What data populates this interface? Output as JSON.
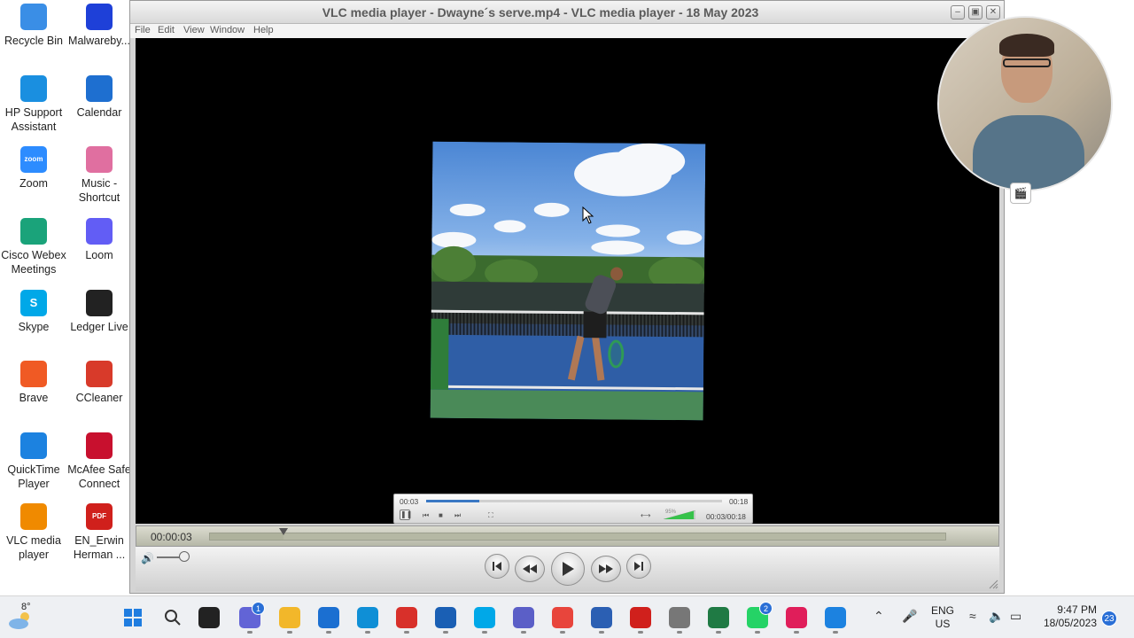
{
  "desktop": {
    "icons": [
      {
        "label": "Recycle Bin",
        "icon": "recycle-bin-icon",
        "color": "#3a8ee6"
      },
      {
        "label": "Malwareby...",
        "icon": "malwarebytes-icon",
        "color": "#1e40d8"
      },
      {
        "label": "HP Support Assistant",
        "icon": "hp-support-icon",
        "color": "#1a8fe0"
      },
      {
        "label": "Calendar",
        "icon": "calendar-icon",
        "color": "#1e6fd0"
      },
      {
        "label": "Zoom",
        "icon": "zoom-icon",
        "color": "#2d8cff",
        "glyph": "zoom"
      },
      {
        "label": "Music - Shortcut",
        "icon": "music-folder-icon",
        "color": "#e06fa0"
      },
      {
        "label": "Cisco Webex Meetings",
        "icon": "webex-icon",
        "color": "#1aa37a"
      },
      {
        "label": "Loom",
        "icon": "loom-icon",
        "color": "#625df5"
      },
      {
        "label": "Skype",
        "icon": "skype-icon",
        "color": "#00a8e8",
        "glyph": "S"
      },
      {
        "label": "Ledger Live",
        "icon": "ledger-icon",
        "color": "#222222"
      },
      {
        "label": "Brave",
        "icon": "brave-icon",
        "color": "#f05a24"
      },
      {
        "label": "CCleaner",
        "icon": "ccleaner-icon",
        "color": "#d83a2a"
      },
      {
        "label": "QuickTime Player",
        "icon": "quicktime-icon",
        "color": "#1c82e0"
      },
      {
        "label": "McAfee Safe Connect",
        "icon": "mcafee-icon",
        "color": "#c8102e"
      },
      {
        "label": "VLC media player",
        "icon": "vlc-icon",
        "color": "#f08a00"
      },
      {
        "label": "EN_Erwin Herman ...",
        "icon": "pdf-file-icon",
        "color": "#d0201c",
        "glyph": "PDF"
      }
    ]
  },
  "vlc": {
    "title": "VLC media player - Dwayne´s serve.mp4 - VLC media player - 18 May 2023",
    "menu": [
      "File",
      "Edit",
      "View",
      "Window",
      "Help"
    ],
    "mini": {
      "elapsed": "00:03",
      "total": "00:18",
      "progress": 0.18,
      "time_readout": "00:03/00:18",
      "volume_label": "95%"
    },
    "elapsed": "00:00:03",
    "progress": 0.1,
    "volume": 0.85
  },
  "taskbar": {
    "weather": "8°",
    "apps": [
      {
        "icon": "start-icon",
        "color": "#1f7de0"
      },
      {
        "icon": "search-icon",
        "color": "#333333"
      },
      {
        "icon": "task-view-icon",
        "color": "#222222"
      },
      {
        "icon": "chat-icon",
        "color": "#6264d6",
        "badge": "1"
      },
      {
        "icon": "file-explorer-icon",
        "color": "#f2b72a"
      },
      {
        "icon": "mail-icon",
        "color": "#1b6fd1"
      },
      {
        "icon": "edge-icon",
        "color": "#0f8fd6"
      },
      {
        "icon": "screen-recorder-icon",
        "color": "#d8302a"
      },
      {
        "icon": "snipping-tool-icon",
        "color": "#1a5fb4"
      },
      {
        "icon": "skype-icon",
        "color": "#00a8e8"
      },
      {
        "icon": "teams-icon",
        "color": "#5b5fc7"
      },
      {
        "icon": "chrome-icon",
        "color": "#e8453c"
      },
      {
        "icon": "word-icon",
        "color": "#2b5fb3"
      },
      {
        "icon": "acrobat-icon",
        "color": "#d0201c"
      },
      {
        "icon": "settings-icon",
        "color": "#777777"
      },
      {
        "icon": "excel-icon",
        "color": "#1f7a44"
      },
      {
        "icon": "whatsapp-icon",
        "color": "#25d366",
        "badge": "2"
      },
      {
        "icon": "slack-icon",
        "color": "#e01e5a"
      },
      {
        "icon": "quicktime-icon",
        "color": "#1c82e0"
      }
    ],
    "lang_top": "ENG",
    "lang_bottom": "US",
    "time": "9:47 PM",
    "date": "18/05/2023",
    "notifications": "23"
  }
}
